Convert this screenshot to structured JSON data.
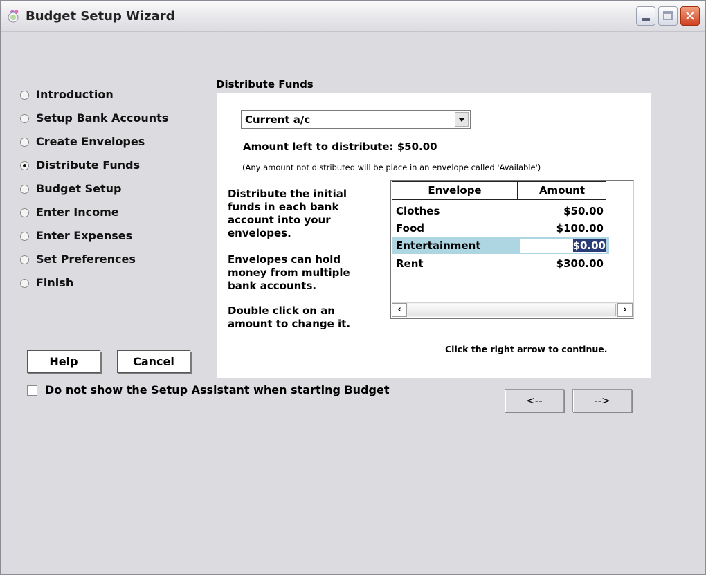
{
  "window": {
    "title": "Budget Setup Wizard",
    "icon": "budget-app-icon",
    "controls": [
      "minimize-icon",
      "maximize-icon",
      "close-icon"
    ],
    "close_glyph": "✕"
  },
  "steps": [
    {
      "label": "Introduction",
      "selected": false
    },
    {
      "label": "Setup Bank Accounts",
      "selected": false
    },
    {
      "label": "Create Envelopes",
      "selected": false
    },
    {
      "label": "Distribute Funds",
      "selected": true
    },
    {
      "label": "Budget Setup",
      "selected": false
    },
    {
      "label": "Enter Income",
      "selected": false
    },
    {
      "label": "Enter Expenses",
      "selected": false
    },
    {
      "label": "Set Preferences",
      "selected": false
    },
    {
      "label": "Finish",
      "selected": false
    }
  ],
  "buttons": {
    "help": "Help",
    "cancel": "Cancel",
    "back": "<--",
    "next": "-->"
  },
  "startup_checkbox": {
    "label": "Do not show the Setup Assistant when starting Budget",
    "checked": false
  },
  "panel": {
    "title": "Distribute Funds",
    "account_select": {
      "value": "Current a/c"
    },
    "amount_left": "Amount left to distribute: $50.00",
    "note": "(Any amount not distributed will be place in an envelope called 'Available')",
    "instructions": [
      "Distribute the initial funds in each bank account into your envelopes.",
      "Envelopes can hold money from multiple bank accounts.",
      "Double click on an amount to change it."
    ],
    "table": {
      "headers": [
        "Envelope",
        "Amount"
      ],
      "rows": [
        {
          "envelope": "Clothes",
          "amount": "$50.00"
        },
        {
          "envelope": "Food",
          "amount": "$100.00"
        },
        {
          "envelope": "Entertainment",
          "amount": "$0.00",
          "selected": true,
          "editing": true
        },
        {
          "envelope": "Rent",
          "amount": "$300.00"
        }
      ]
    },
    "continue_hint": "Click the right arrow to continue."
  },
  "colors": {
    "window_bg": "#dcdce0",
    "panel_bg": "#ffffff",
    "selected_row": "#aed6e2",
    "edit_highlight": "#2a3c78",
    "close_button": "#d04020"
  }
}
